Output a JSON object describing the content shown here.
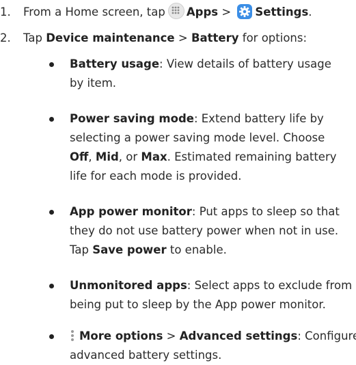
{
  "steps": [
    {
      "number": "1.",
      "prefix": "From a Home screen, tap",
      "apps_label": "Apps",
      "separator": ">",
      "settings_label": "Settings",
      "suffix": "."
    },
    {
      "number": "2.",
      "prefix": "Tap",
      "device_maintenance": "Device maintenance",
      "separator": ">",
      "battery": "Battery",
      "suffix": "for options:"
    }
  ],
  "bullets": [
    {
      "term": "Battery usage",
      "line1_rest": ": View details of battery usage",
      "line2": "by item."
    },
    {
      "term": "Power saving mode",
      "line1_rest": ": Extend battery life by",
      "line2": "selecting a power saving mode level. Choose",
      "line3_off": "Off",
      "line3_sep1": ", ",
      "line3_mid": "Mid",
      "line3_sep2": ", or ",
      "line3_max": "Max",
      "line3_rest": ". Estimated remaining battery",
      "line4": "life for each mode is provided."
    },
    {
      "term": "App power monitor",
      "line1_rest": ": Put apps to sleep so that",
      "line2": "they do not use battery power when not in use.",
      "line3_pre": "Tap ",
      "line3_bold": "Save power",
      "line3_rest": " to enable."
    },
    {
      "term": "Unmonitored apps",
      "line1_rest": ": Select apps to exclude from",
      "line2": "being put to sleep by the App power monitor."
    },
    {
      "term": "More options",
      "separator": ">",
      "term2": "Advanced settings",
      "line1_rest": ": Configure",
      "line2": "advanced battery settings."
    }
  ],
  "icons": {
    "apps": "apps-grid-icon",
    "settings": "settings-gear-icon",
    "more": "more-options-icon"
  },
  "colors": {
    "text": "#2b2b2b",
    "settings_icon_bg": "#3b8ee6",
    "apps_icon_bg": "#e8e8e8"
  }
}
